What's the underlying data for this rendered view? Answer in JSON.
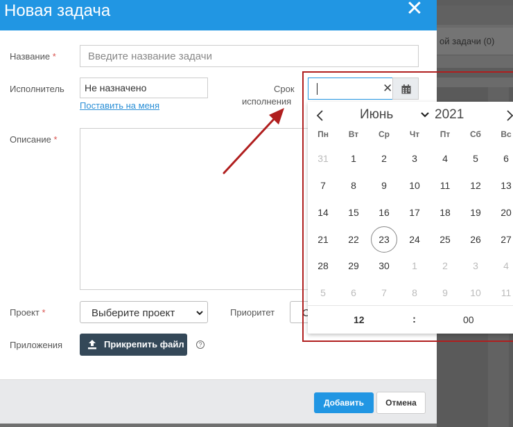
{
  "modal": {
    "title": "Новая задача",
    "close_glyph": "✕"
  },
  "form": {
    "name": {
      "label": "Название",
      "required": "*",
      "placeholder": "Введите название задачи"
    },
    "assignee": {
      "label": "Исполнитель",
      "value": "Не назначено",
      "link": "Поставить на меня"
    },
    "due": {
      "label_line1": "Срок",
      "label_line2": "исполнения"
    },
    "description": {
      "label": "Описание",
      "required": "*"
    },
    "project": {
      "label": "Проект",
      "required": "*",
      "value": "Выберите проект"
    },
    "priority": {
      "label": "Приоритет",
      "value": "С"
    },
    "attachments": {
      "label": "Приложения",
      "button": "Прикрепить файл",
      "help": "?"
    }
  },
  "footer": {
    "submit": "Добавить",
    "cancel": "Отмена"
  },
  "date_input": {
    "clear_glyph": "✕"
  },
  "calendar": {
    "month": "Июнь",
    "year": "2021",
    "weekdays": [
      "Пн",
      "Вт",
      "Ср",
      "Чт",
      "Пт",
      "Сб",
      "Вс"
    ],
    "weeks": [
      [
        "31",
        "1",
        "2",
        "3",
        "4",
        "5",
        "6"
      ],
      [
        "7",
        "8",
        "9",
        "10",
        "11",
        "12",
        "13"
      ],
      [
        "14",
        "15",
        "16",
        "17",
        "18",
        "19",
        "20"
      ],
      [
        "21",
        "22",
        "23",
        "24",
        "25",
        "26",
        "27"
      ],
      [
        "28",
        "29",
        "30",
        "1",
        "2",
        "3",
        "4"
      ],
      [
        "5",
        "6",
        "7",
        "8",
        "9",
        "10",
        "11"
      ]
    ],
    "today": "23",
    "time": {
      "hours": "12",
      "separator": ":",
      "minutes": "00"
    }
  },
  "background": {
    "tab_label": "ой задачи (0)"
  },
  "colors": {
    "accent": "#2196e3",
    "header_bg": "#2196e3",
    "button_dark": "#344858",
    "highlight": "#b01e1e",
    "required": "#d9534f"
  }
}
